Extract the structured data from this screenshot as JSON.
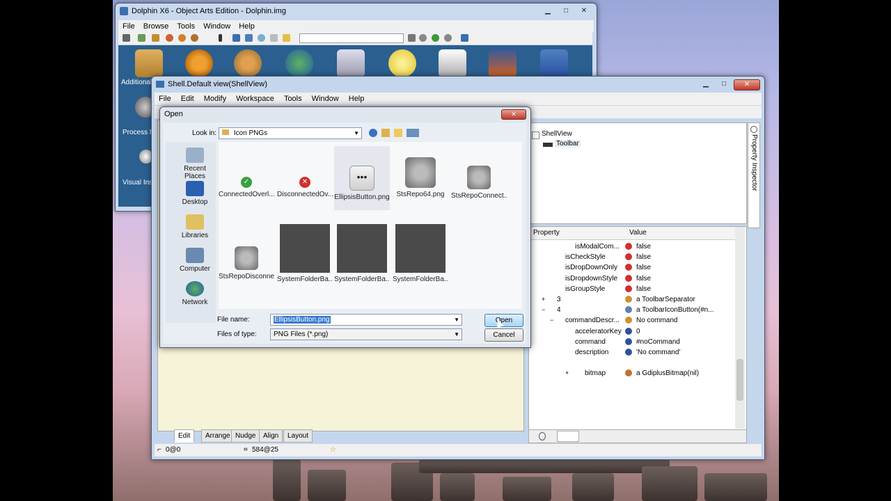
{
  "dolphin": {
    "title": "Dolphin X6 - Object Arts Edition - Dolphin.img",
    "menu": [
      "File",
      "Browse",
      "Tools",
      "Window",
      "Help"
    ],
    "big_icons": [
      "Additional",
      "Process M",
      "Visual Ins"
    ]
  },
  "shell": {
    "title": "Shell.Default view(ShellView)",
    "menu": [
      "File",
      "Edit",
      "Modify",
      "Workspace",
      "Tools",
      "Window",
      "Help"
    ],
    "tree": [
      "ShellView",
      "Toolbar"
    ],
    "side_tab": "Property Inspector",
    "columns": {
      "property": "Property",
      "value": "Value"
    },
    "properties": [
      {
        "exp": "",
        "name": "isModalCom...",
        "icon": "false-icon",
        "value": "false"
      },
      {
        "exp": "",
        "name": "isCheckStyle",
        "icon": "false-icon",
        "value": "false"
      },
      {
        "exp": "",
        "name": "isDropDownOnly",
        "icon": "false-icon",
        "value": "false"
      },
      {
        "exp": "",
        "name": "isDropdownStyle",
        "icon": "false-icon",
        "value": "false"
      },
      {
        "exp": "",
        "name": "isGroupStyle",
        "icon": "false-icon",
        "value": "false"
      },
      {
        "exp": "+",
        "name": "3",
        "icon": "object-icon",
        "value": "a ToolbarSeparator"
      },
      {
        "exp": "−",
        "name": "4",
        "icon": "button-icon",
        "value": "a ToolbarIconButton(#n..."
      },
      {
        "exp": "−",
        "name": "commandDescr...",
        "icon": "object-icon",
        "value": "No command"
      },
      {
        "exp": "",
        "name": "acceleratorKey",
        "icon": "number-icon",
        "value": "0"
      },
      {
        "exp": "",
        "name": "command",
        "icon": "symbol-icon",
        "value": "#noCommand"
      },
      {
        "exp": "",
        "name": "description",
        "icon": "string-icon",
        "value": "'No command'"
      },
      {
        "exp": "+",
        "name": "bitmap",
        "icon": "bitmap-icon",
        "value": "a GdiplusBitmap(nil)"
      }
    ],
    "bottom_tabs": [
      "Edit",
      "Arrange",
      "Nudge",
      "Align",
      "Layout"
    ],
    "status": {
      "pos": "0@0",
      "size": "584@25"
    }
  },
  "open_dialog": {
    "title": "Open",
    "look_in_label": "Look in:",
    "look_in_value": "Icon PNGs",
    "places": [
      "Recent Places",
      "Desktop",
      "Libraries",
      "Computer",
      "Network"
    ],
    "files": [
      {
        "name": "ConnectedOverl...",
        "kind": "check"
      },
      {
        "name": "DisconnectedOv...",
        "kind": "cross"
      },
      {
        "name": "EllipsisButton.png",
        "kind": "ellipsis"
      },
      {
        "name": "StsRepo64.png",
        "kind": "safe"
      },
      {
        "name": "StsRepoConnect...",
        "kind": "safe-check"
      },
      {
        "name": "StsRepoDisconne...",
        "kind": "safe-cross"
      },
      {
        "name": "SystemFolderBa...",
        "kind": "dark"
      },
      {
        "name": "SystemFolderBa...",
        "kind": "dark"
      },
      {
        "name": "SystemFolderBa...",
        "kind": "dark"
      }
    ],
    "file_name_label": "File name:",
    "file_name_value": "EllipsisButton.png",
    "file_type_label": "Files of type:",
    "file_type_value": "PNG Files (*.png)",
    "open_button": "Open",
    "cancel_button": "Cancel"
  }
}
